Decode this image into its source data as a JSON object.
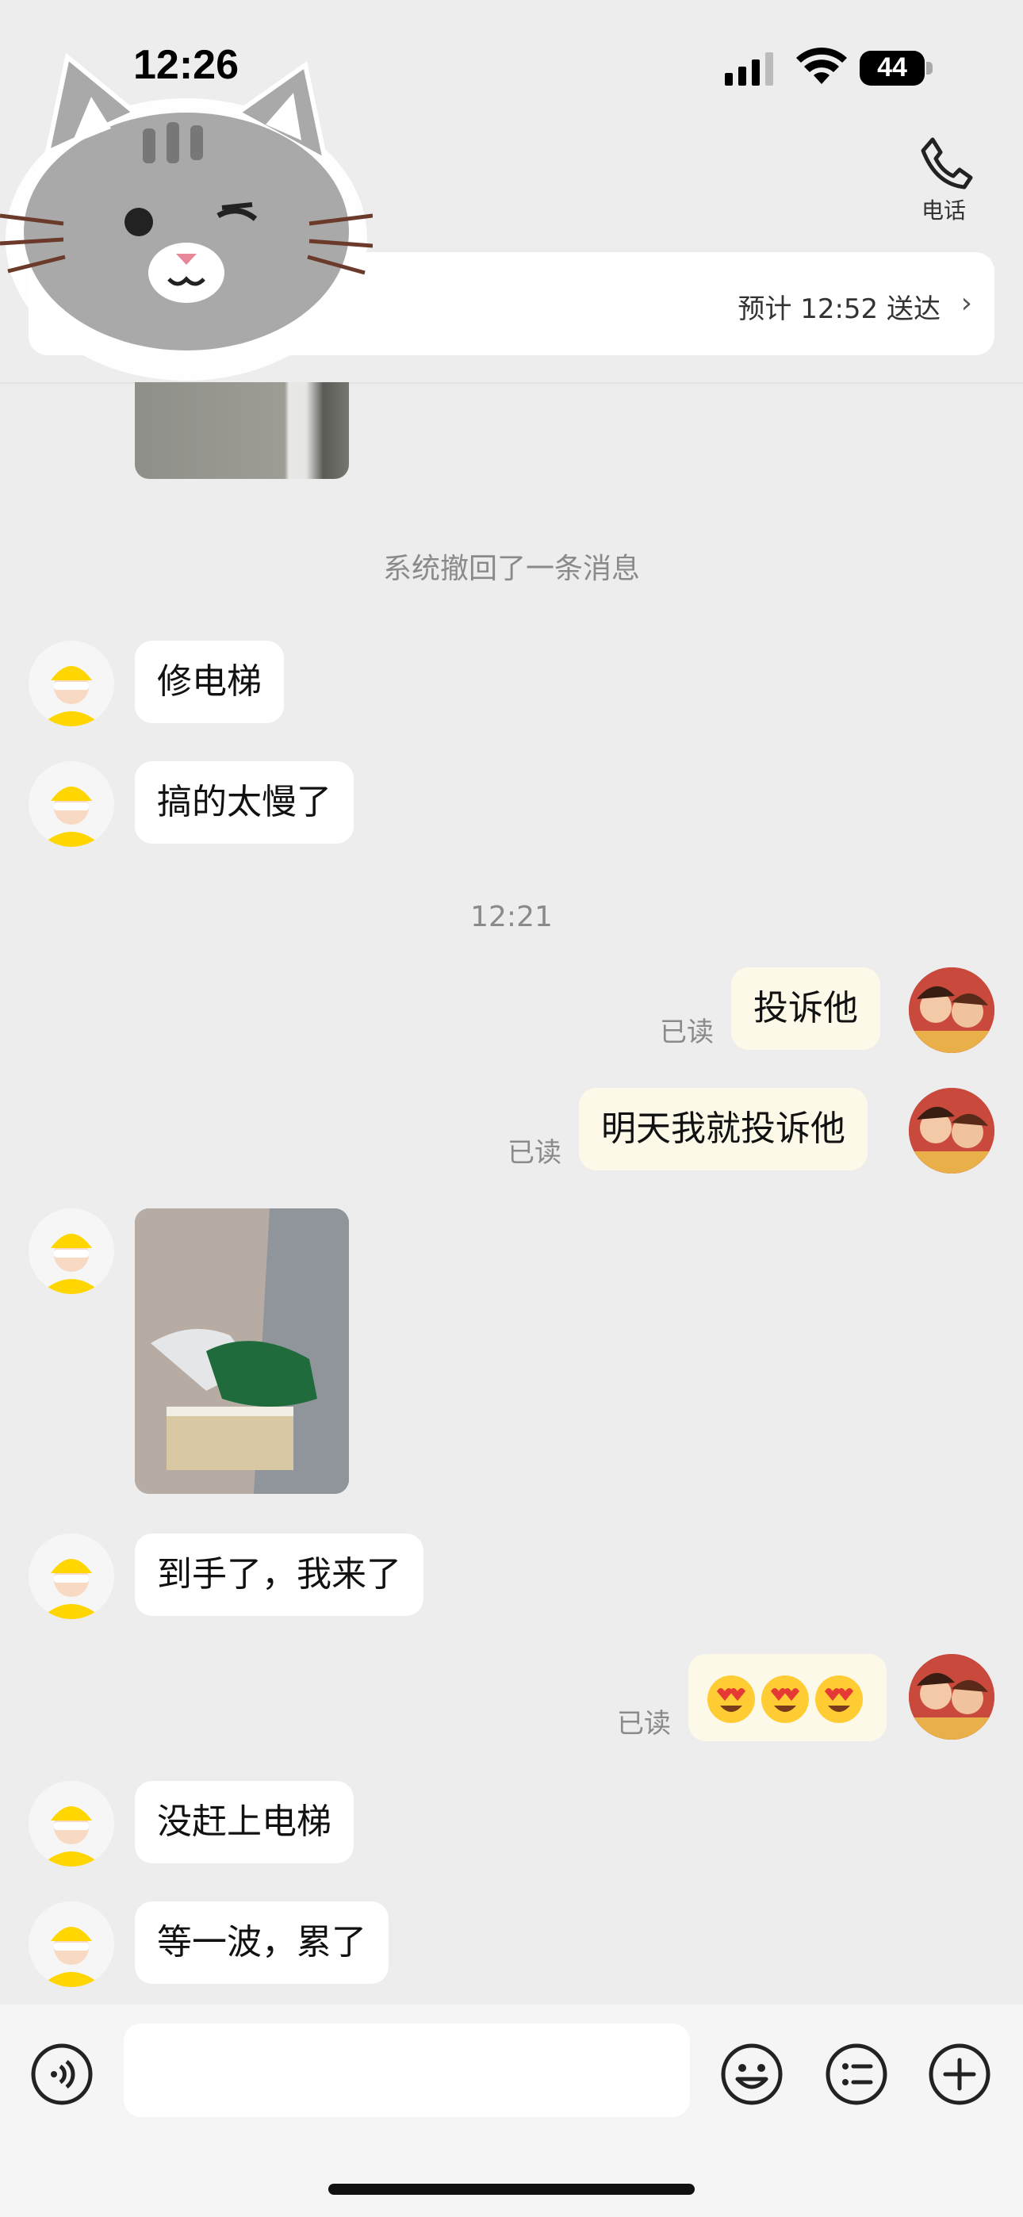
{
  "status_bar": {
    "time": "12:26",
    "battery": "44"
  },
  "header": {
    "phone_label": "电话"
  },
  "delivery_card": {
    "eta": "预计 12:52 送达",
    "chevron": "›"
  },
  "timeline": {
    "system_recall": "系统撤回了一条消息",
    "timestamp": "12:21"
  },
  "messages": {
    "rider_1": "修电梯",
    "rider_2": "搞的太慢了",
    "user_1": "投诉他",
    "user_2": "明天我就投诉他",
    "rider_3": "到手了，我来了",
    "rider_4": "没赶上电梯",
    "rider_5": "等一波，累了"
  },
  "read_status": "已读",
  "input": {
    "placeholder": ""
  },
  "colors": {
    "background": "#ededed",
    "incoming_bubble": "#ffffff",
    "outgoing_bubble": "#fdf9e9",
    "rider_avatar_accent": "#ffd600"
  },
  "icons": {
    "phone": "phone-icon",
    "voice": "voice-icon",
    "emoji": "emoji-icon",
    "quick_reply": "list-icon",
    "add": "plus-icon"
  }
}
